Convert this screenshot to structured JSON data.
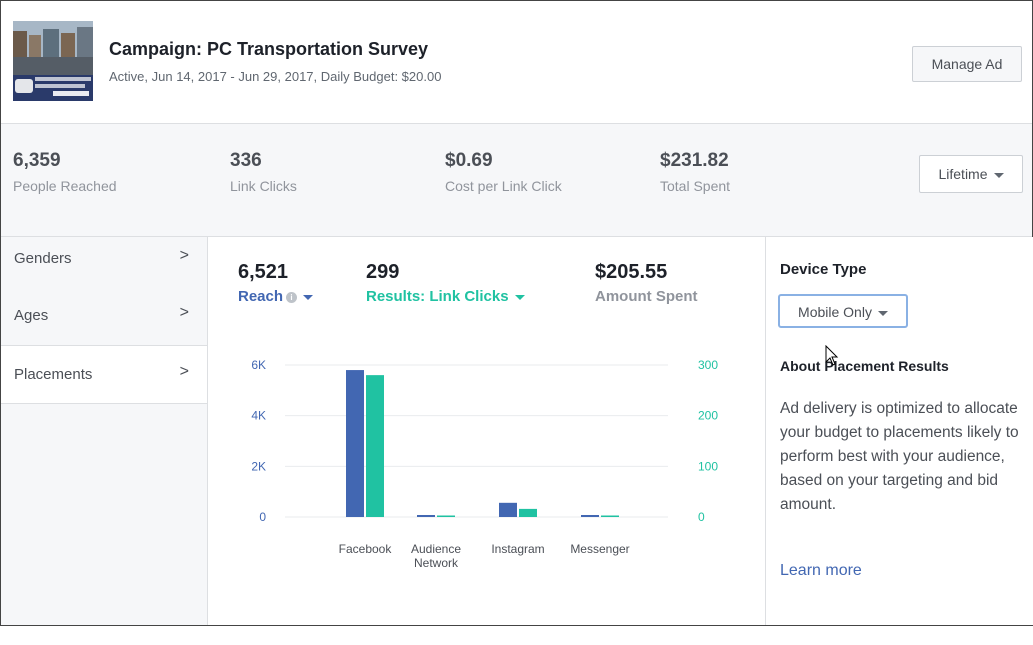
{
  "campaign": {
    "title": "Campaign: PC Transportation Survey",
    "subtitle": "Active, Jun 14, 2017 - Jun 29, 2017, Daily Budget: $20.00",
    "manage_label": "Manage Ad"
  },
  "stats": [
    {
      "value": "6,359",
      "label": "People Reached"
    },
    {
      "value": "336",
      "label": "Link Clicks"
    },
    {
      "value": "$0.69",
      "label": "Cost per Link Click"
    },
    {
      "value": "$231.82",
      "label": "Total Spent"
    }
  ],
  "lifetime_label": "Lifetime",
  "sidebar": {
    "items": [
      {
        "label": "Genders"
      },
      {
        "label": "Ages"
      },
      {
        "label": "Placements"
      }
    ]
  },
  "metrics": {
    "reach": {
      "value": "6,521",
      "label": "Reach"
    },
    "results": {
      "value": "299",
      "label": "Results: Link Clicks"
    },
    "spent": {
      "value": "$205.55",
      "label": "Amount Spent"
    }
  },
  "colors": {
    "reach": "#4267b2",
    "results": "#20c2a2",
    "muted": "#90949c"
  },
  "chart_data": {
    "type": "bar",
    "categories": [
      "Facebook",
      "Audience Network",
      "Instagram",
      "Messenger"
    ],
    "series": [
      {
        "name": "Reach",
        "axis": "left",
        "values": [
          5800,
          60,
          560,
          15
        ]
      },
      {
        "name": "Results: Link Clicks",
        "axis": "right",
        "values": [
          280,
          2,
          16,
          0
        ]
      }
    ],
    "left_ticks": [
      "0",
      "2K",
      "4K",
      "6K"
    ],
    "right_ticks": [
      "0",
      "100",
      "200",
      "300"
    ],
    "left_range": [
      0,
      6000
    ],
    "right_range": [
      0,
      300
    ],
    "grid": true
  },
  "right_panel": {
    "device_title": "Device Type",
    "device_selected": "Mobile Only",
    "about_title": "About Placement Results",
    "about_body": "Ad delivery is optimized to allocate your budget to placements likely to perform best with your audience, based on your targeting and bid amount.",
    "learn_more": "Learn more"
  }
}
